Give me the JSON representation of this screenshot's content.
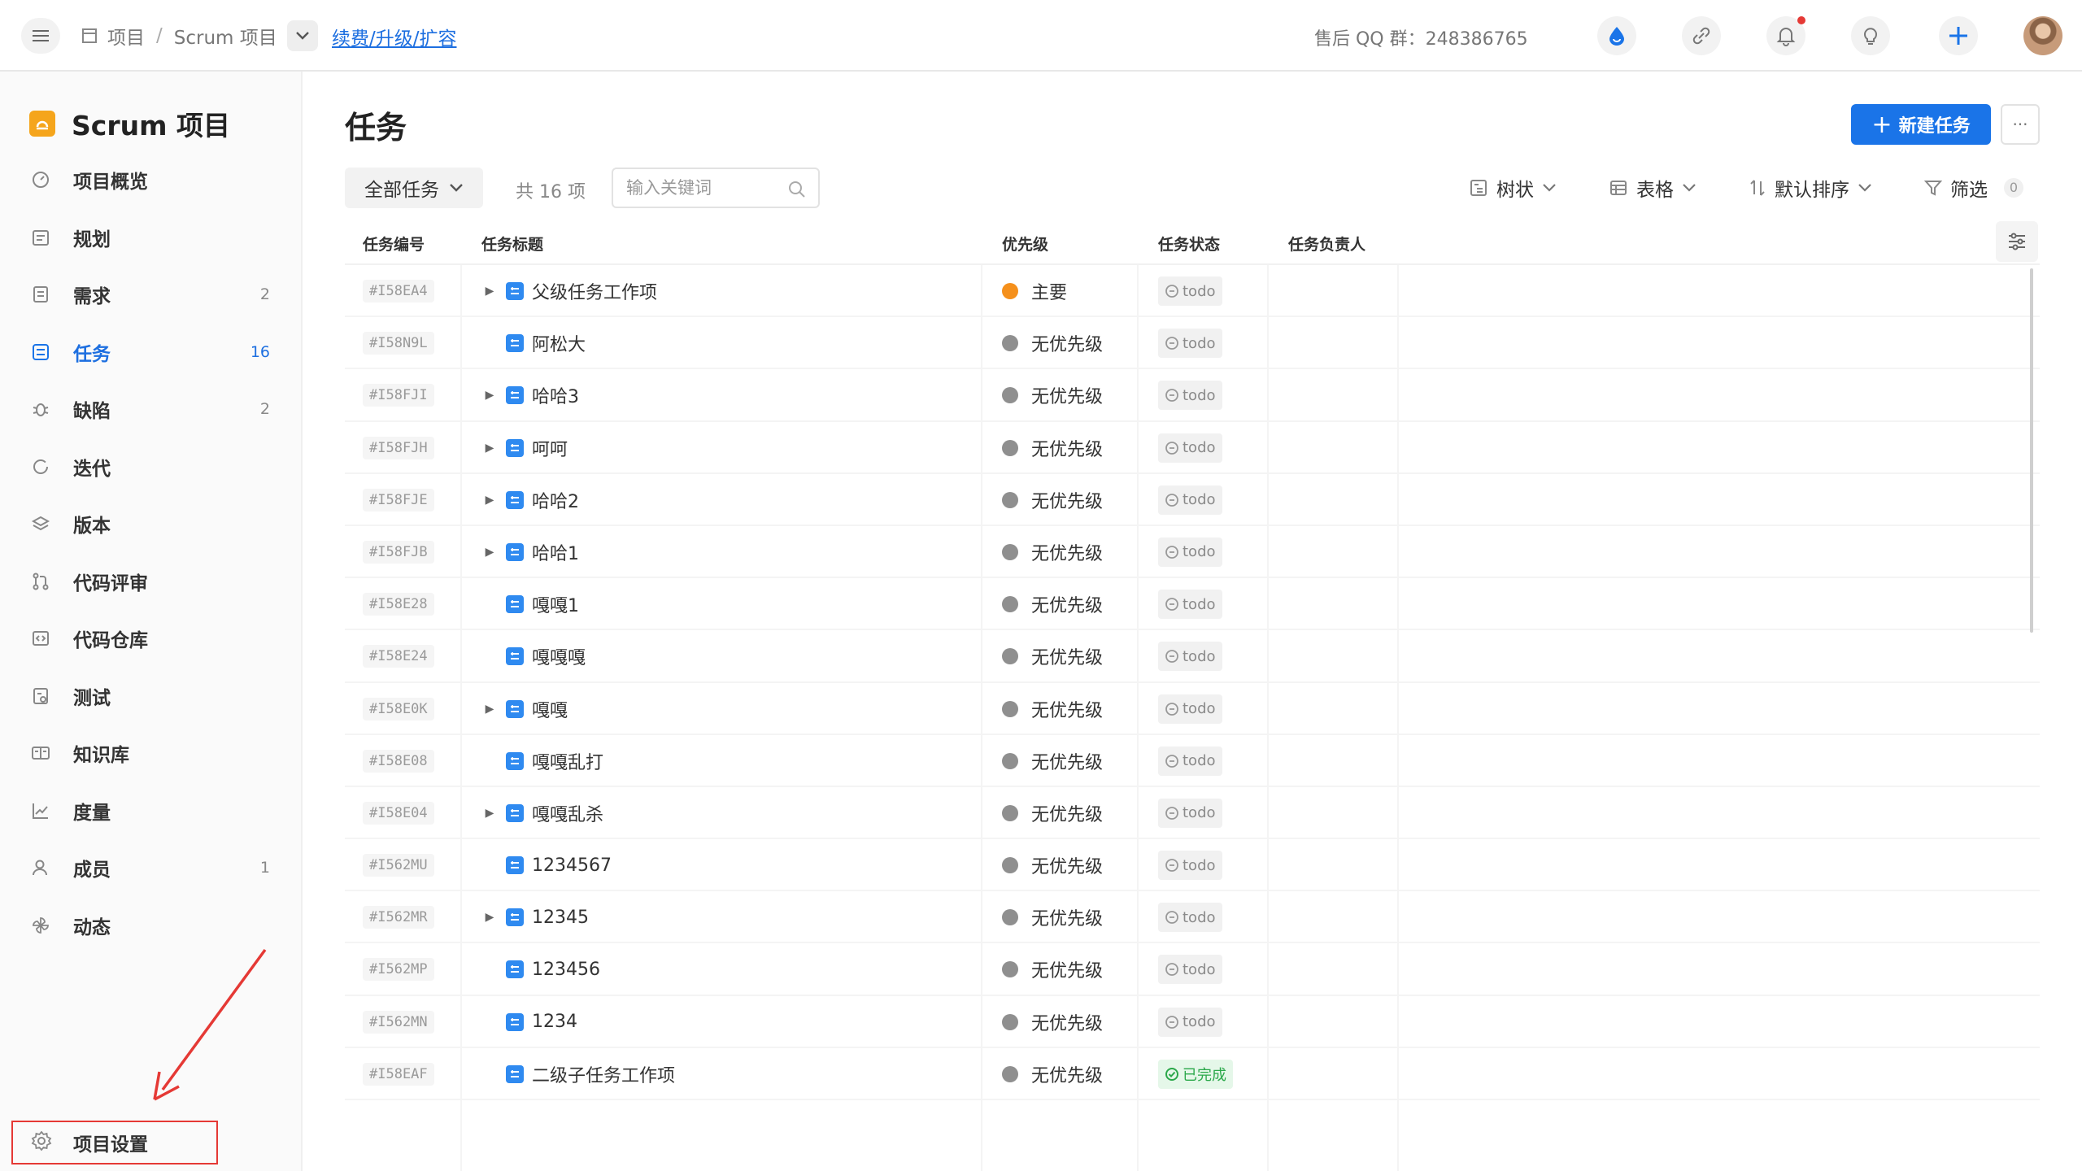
{
  "header": {
    "breadcrumb": [
      "项目",
      "Scrum 项目"
    ],
    "separator": "/",
    "renew_link": "续费/升级/扩容",
    "qq_group": "售后 QQ 群：248386765"
  },
  "sidebar": {
    "project_title": "Scrum 项目",
    "items": [
      {
        "label": "项目概览",
        "count": ""
      },
      {
        "label": "规划",
        "count": ""
      },
      {
        "label": "需求",
        "count": "2"
      },
      {
        "label": "任务",
        "count": "16"
      },
      {
        "label": "缺陷",
        "count": "2"
      },
      {
        "label": "迭代",
        "count": ""
      },
      {
        "label": "版本",
        "count": ""
      },
      {
        "label": "代码评审",
        "count": ""
      },
      {
        "label": "代码仓库",
        "count": ""
      },
      {
        "label": "测试",
        "count": ""
      },
      {
        "label": "知识库",
        "count": ""
      },
      {
        "label": "度量",
        "count": ""
      },
      {
        "label": "成员",
        "count": "1"
      },
      {
        "label": "动态",
        "count": ""
      }
    ],
    "settings_label": "项目设置"
  },
  "main": {
    "title": "任务",
    "new_button": "新建任务",
    "more_button": "···",
    "filter_label": "全部任务",
    "total_text": "共 16 项",
    "search_placeholder": "输入关键词",
    "view_tree": "树状",
    "view_table": "表格",
    "sort_label": "默认排序",
    "filter_btn": "筛选",
    "filter_count": "0"
  },
  "table": {
    "headers": [
      "任务编号",
      "任务标题",
      "优先级",
      "任务状态",
      "任务负责人"
    ],
    "rows": [
      {
        "id": "#I58EA4",
        "title": "父级任务工作项",
        "expand": true,
        "priority": "主要",
        "status": "todo"
      },
      {
        "id": "#I58N9L",
        "title": "阿松大",
        "expand": false,
        "priority": "无优先级",
        "status": "todo"
      },
      {
        "id": "#I58FJI",
        "title": "哈哈3",
        "expand": true,
        "priority": "无优先级",
        "status": "todo"
      },
      {
        "id": "#I58FJH",
        "title": "呵呵",
        "expand": true,
        "priority": "无优先级",
        "status": "todo"
      },
      {
        "id": "#I58FJE",
        "title": "哈哈2",
        "expand": true,
        "priority": "无优先级",
        "status": "todo"
      },
      {
        "id": "#I58FJB",
        "title": "哈哈1",
        "expand": true,
        "priority": "无优先级",
        "status": "todo"
      },
      {
        "id": "#I58E28",
        "title": "嘎嘎1",
        "expand": false,
        "priority": "无优先级",
        "status": "todo"
      },
      {
        "id": "#I58E24",
        "title": "嘎嘎嘎",
        "expand": false,
        "priority": "无优先级",
        "status": "todo"
      },
      {
        "id": "#I58E0K",
        "title": "嘎嘎",
        "expand": true,
        "priority": "无优先级",
        "status": "todo"
      },
      {
        "id": "#I58E08",
        "title": "嘎嘎乱打",
        "expand": false,
        "priority": "无优先级",
        "status": "todo"
      },
      {
        "id": "#I58E04",
        "title": "嘎嘎乱杀",
        "expand": true,
        "priority": "无优先级",
        "status": "todo"
      },
      {
        "id": "#I562MU",
        "title": "1234567",
        "expand": false,
        "priority": "无优先级",
        "status": "todo"
      },
      {
        "id": "#I562MR",
        "title": "12345",
        "expand": true,
        "priority": "无优先级",
        "status": "todo"
      },
      {
        "id": "#I562MP",
        "title": "123456",
        "expand": false,
        "priority": "无优先级",
        "status": "todo"
      },
      {
        "id": "#I562MN",
        "title": "1234",
        "expand": false,
        "priority": "无优先级",
        "status": "todo"
      },
      {
        "id": "#I58EAF",
        "title": "二级子任务工作项",
        "expand": false,
        "priority": "无优先级",
        "status": "已完成"
      }
    ]
  },
  "colors": {
    "accent": "#1a74e8",
    "priority_major": "#f5901c",
    "priority_none": "#8f8f8f",
    "done": "#2ba84a",
    "annotation": "#e53935"
  }
}
